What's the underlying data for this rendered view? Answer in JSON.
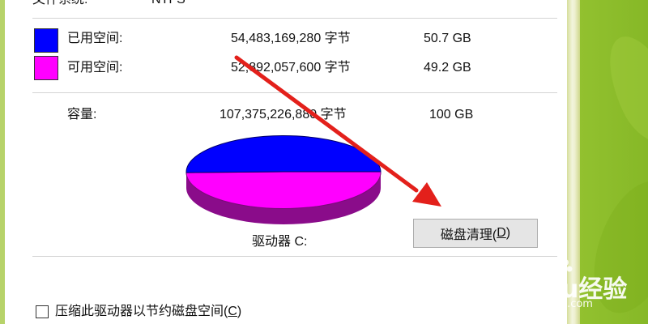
{
  "filesystem": {
    "label": "文件系统:",
    "value": "NTFS"
  },
  "used": {
    "label": "已用空间:",
    "bytes": "54,483,169,280 字节",
    "size": "50.7 GB",
    "color": "#0000ff"
  },
  "free": {
    "label": "可用空间:",
    "bytes": "52,892,057,600 字节",
    "size": "49.2 GB",
    "color": "#ff00ff"
  },
  "capacity": {
    "label": "容量:",
    "bytes": "107,375,226,880 字节",
    "size": "100 GB"
  },
  "drive_label": "驱动器 C:",
  "cleanup_button": {
    "label_prefix": "磁盘清理(",
    "access_key": "D",
    "label_suffix": ")"
  },
  "compress_checkbox": {
    "label_prefix": "压缩此驱动器以节约磁盘空间(",
    "access_key": "C",
    "label_suffix": ")",
    "checked": false
  },
  "usage": {
    "used_fraction": 0.507,
    "free_fraction": 0.493
  },
  "watermark": {
    "brand": "Baidu经验",
    "url": "jingyan.baidu.com"
  },
  "annotation": {
    "type": "red-arrow",
    "color": "#e3201b"
  }
}
